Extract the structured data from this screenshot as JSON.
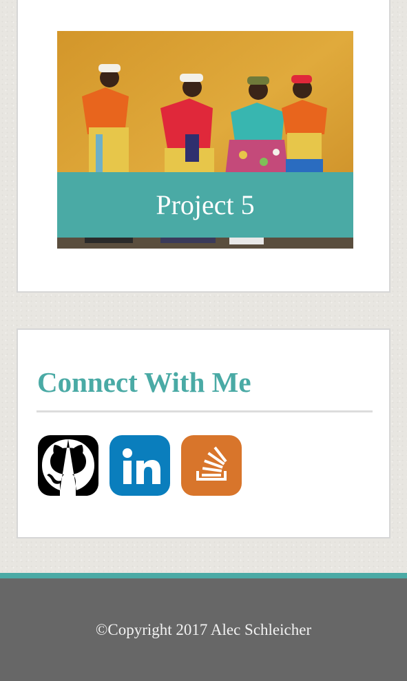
{
  "project": {
    "label": "Project 5",
    "label_bg": "#4aaaa5"
  },
  "connect": {
    "title": "Connect With Me",
    "title_color": "#4aaaa5",
    "links": [
      {
        "icon": "github-icon",
        "color": "#000000"
      },
      {
        "icon": "linkedin-icon",
        "color": "#0a7ebd"
      },
      {
        "icon": "stackoverflow-icon",
        "color": "#d8752b"
      }
    ]
  },
  "footer": {
    "copyright": "©Copyright 2017 Alec Schleicher",
    "accent_color": "#4aaaa5",
    "bg_color": "#676767"
  }
}
